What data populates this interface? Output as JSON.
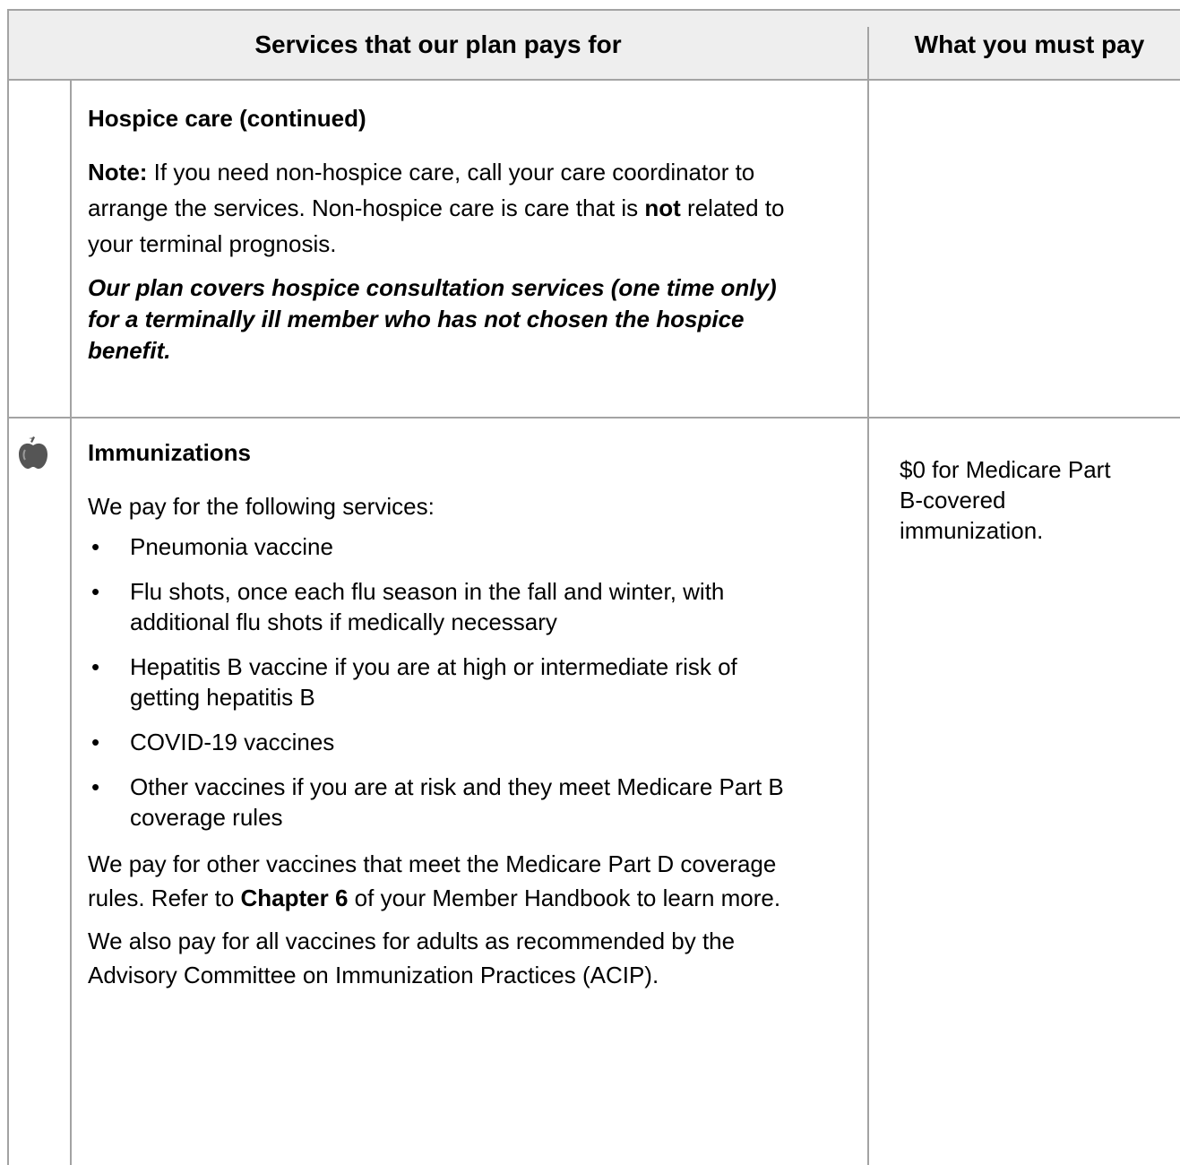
{
  "header": {
    "services_label": "Services that our plan pays for",
    "pay_label": "What you must pay"
  },
  "rows": [
    {
      "title": "Hospice care (continued)",
      "note_bold": "Note:",
      "note_text_1": " If you need non-hospice care, call your care coordinator to arrange the services. Non-hospice care is care that is ",
      "note_not": "not",
      "note_text_2": " related to your terminal prognosis.",
      "consultation": "Our plan covers hospice consultation services (one time only) for a terminally ill member who has not chosen the hospice benefit.",
      "pay": ""
    },
    {
      "icon": "apple-icon",
      "title": "Immunizations",
      "intro": "We pay for the following services:",
      "bullets": [
        "Pneumonia vaccine",
        "Flu shots, once each flu season in the fall and winter, with additional flu shots if medically necessary",
        "Hepatitis B vaccine if you are at high or intermediate risk of getting hepatitis B",
        "COVID-19 vaccines",
        "Other vaccines if you are at risk and they meet Medicare Part B coverage rules"
      ],
      "part_d_text_1": "We pay for other vaccines that meet the Medicare Part D coverage rules. Refer to ",
      "part_d_bold": "Chapter 6",
      "part_d_text_2": " of your Member Handbook to learn more.",
      "acip": "We also pay for all vaccines for adults as recommended by the Advisory Committee on Immunization Practices (ACIP).",
      "pay": "$0 for Medicare Part B-covered immunization."
    }
  ],
  "colors": {
    "header_bg": "#eeeeee",
    "grid_line": "#a3a3a3",
    "icon": "#555555"
  }
}
